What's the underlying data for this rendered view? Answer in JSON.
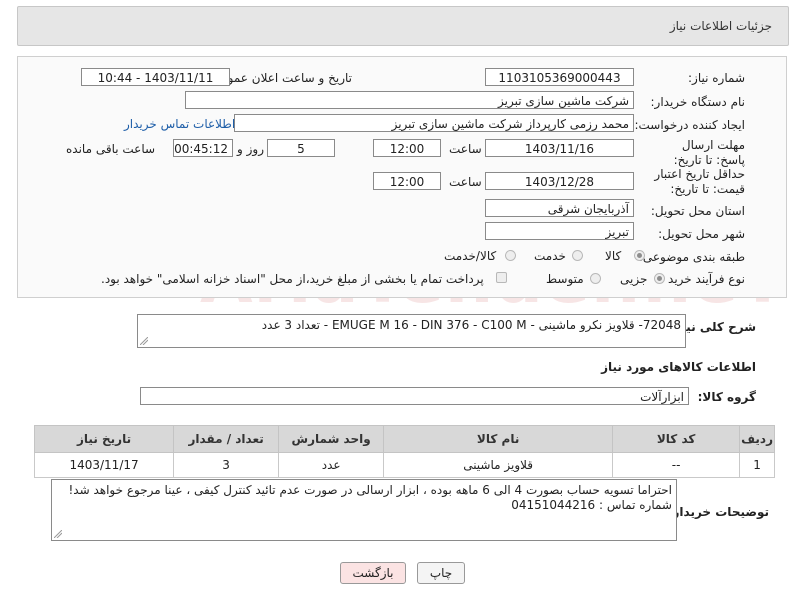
{
  "header": {
    "title": "جزئیات اطلاعات نیاز"
  },
  "form": {
    "need_number_label": "شماره نیاز:",
    "need_number": "1103105369000443",
    "announce_label": "تاریخ و ساعت اعلان عمومی:",
    "announce_value": "1403/11/11 - 10:44",
    "buyer_org_label": "نام دستگاه خریدار:",
    "buyer_org": "شرکت ماشین سازی تبریز",
    "creator_label": "ایجاد کننده درخواست:",
    "creator": "محمد رزمی کارپرداز شرکت ماشین سازی تبریز",
    "contact_link": "اطلاعات تماس خریدار",
    "deadline_label": "مهلت ارسال پاسخ: تا تاریخ:",
    "deadline_date": "1403/11/16",
    "time_label": "ساعت",
    "deadline_time": "12:00",
    "days": "5",
    "days_label": "روز و",
    "remaining": "00:45:12",
    "remaining_label": "ساعت باقی مانده",
    "validity_label": "حداقل تاریخ اعتبار قیمت: تا تاریخ:",
    "validity_date": "1403/12/28",
    "validity_time": "12:00",
    "province_label": "استان محل تحویل:",
    "province": "آذربایجان شرقی",
    "city_label": "شهر محل تحویل:",
    "city": "تبریز",
    "category_label": "طبقه بندی موضوعی:",
    "category_options": [
      "کالا",
      "خدمت",
      "کالا/خدمت"
    ],
    "process_label": "نوع فرآیند خرید :",
    "process_options": [
      "جزیی",
      "متوسط"
    ],
    "payment_note": "پرداخت تمام یا بخشی از مبلغ خرید،از محل \"اسناد خزانه اسلامی\" خواهد بود."
  },
  "summary": {
    "label": "شرح کلی نیاز:",
    "text": "72048- قلاویز نکرو ماشینی - EMUGE  M 16 - DIN 376 - C100 M - تعداد 3 عدد"
  },
  "goods_section_title": "اطلاعات کالاهای مورد نیاز",
  "goods_group": {
    "label": "گروه کالا:",
    "value": "ابزارآلات"
  },
  "table": {
    "headers": [
      "ردیف",
      "کد کالا",
      "نام کالا",
      "واحد شمارش",
      "تعداد / مقدار",
      "تاریخ نیاز"
    ],
    "rows": [
      [
        "1",
        "--",
        "قلاویز ماشینی",
        "عدد",
        "3",
        "1403/11/17"
      ]
    ]
  },
  "buyer_notes": {
    "label": "توضیحات خریدار:",
    "line1": "احتراما تسویه حساب بصورت 4 الی 6 ماهه بوده ، ابزار ارسالی در صورت عدم تائید کنترل کیفی ، عینا مرجوع خواهد شد!",
    "line2": "شماره تماس : 04151044216"
  },
  "buttons": {
    "print": "چاپ",
    "back": "بازگشت"
  },
  "watermark": "AriaTender.neT",
  "colors": {
    "link": "#1e5ea8",
    "back_button_bg": "#fbe3e3"
  }
}
